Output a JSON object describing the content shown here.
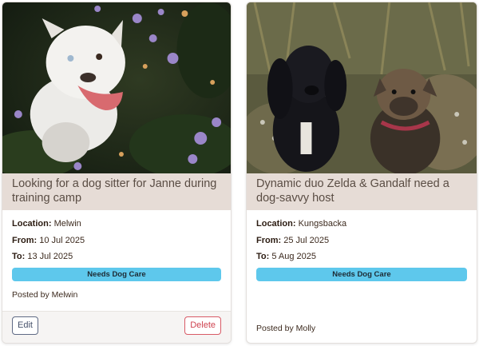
{
  "listings": [
    {
      "photo_icon": "white-bulldog-photo",
      "title": "Looking for a dog sitter for Janne during training camp",
      "location_label": "Location:",
      "location": "Melwin",
      "from_label": "From:",
      "from": "10 Jul 2025",
      "to_label": "To:",
      "to": "13 Jul 2025",
      "badge": "Needs Dog Care",
      "posted_by": "Posted by Melwin",
      "edit_label": "Edit",
      "delete_label": "Delete"
    },
    {
      "photo_icon": "two-dogs-photo",
      "title": "Dynamic duo Zelda & Gandalf need a dog-savvy host",
      "location_label": "Location:",
      "location": "Kungsbacka",
      "from_label": "From:",
      "from": "25 Jul 2025",
      "to_label": "To:",
      "to": "5 Aug 2025",
      "badge": "Needs Dog Care",
      "posted_by": "Posted by Molly"
    }
  ],
  "colors": {
    "title_band": "#e6dcd6",
    "badge": "#5ec8ec",
    "edit_border": "#5f6a84",
    "delete_border": "#d85a66"
  }
}
